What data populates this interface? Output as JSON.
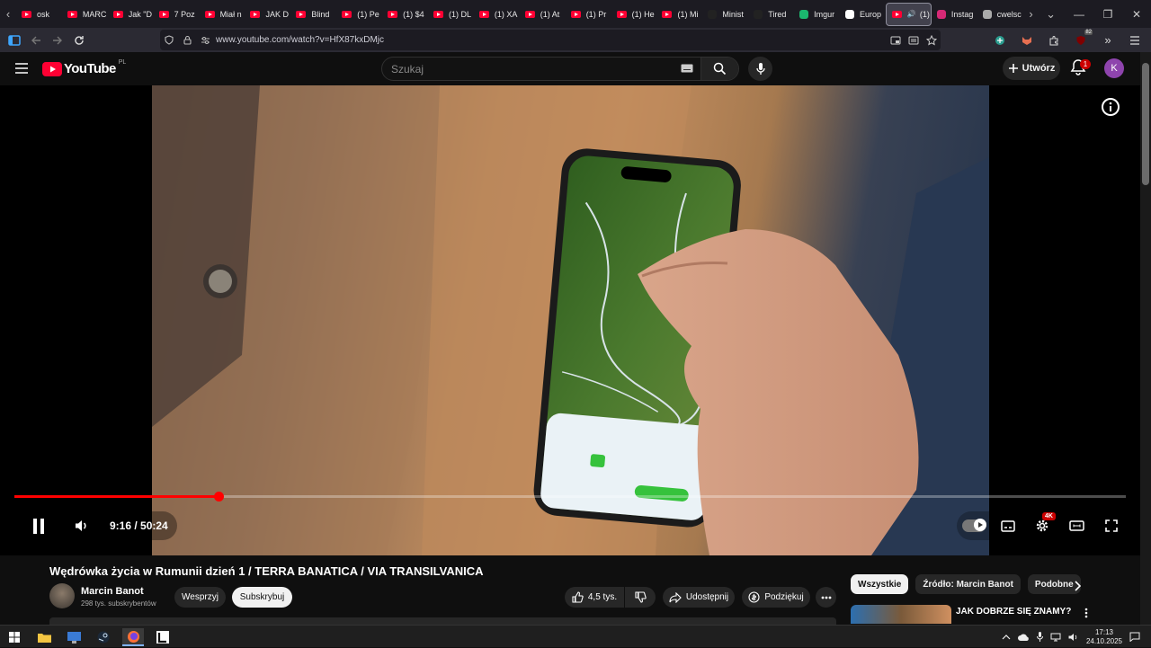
{
  "browser": {
    "tabs": [
      {
        "label": "osk",
        "active": false
      },
      {
        "label": "MARC",
        "active": false
      },
      {
        "label": "Jak \"D",
        "active": false
      },
      {
        "label": "7 Poz",
        "active": false
      },
      {
        "label": "Miał n",
        "active": false
      },
      {
        "label": "JAK D",
        "active": false
      },
      {
        "label": "Blind",
        "active": false
      },
      {
        "label": "(1) Pe",
        "active": false
      },
      {
        "label": "(1) $4",
        "active": false
      },
      {
        "label": "(1) DL",
        "active": false
      },
      {
        "label": "(1) XA",
        "active": false
      },
      {
        "label": "(1) At",
        "active": false
      },
      {
        "label": "(1) Pr",
        "active": false
      },
      {
        "label": "(1) He",
        "active": false
      },
      {
        "label": "(1) Mi",
        "active": false
      },
      {
        "label": "Minist",
        "active": false
      },
      {
        "label": "Tired",
        "active": false
      },
      {
        "label": "Imgur",
        "active": false
      },
      {
        "label": "Europ",
        "active": false
      },
      {
        "label": "(1)",
        "active": true
      },
      {
        "label": "Instag",
        "active": false
      },
      {
        "label": "cwelsc",
        "active": false
      }
    ],
    "url": "www.youtube.com/watch?v=HfX87kxDMjc",
    "extension_badge": "82"
  },
  "youtube": {
    "logo_text": "YouTube",
    "region": "PL",
    "search_placeholder": "Szukaj",
    "create_label": "Utwórz",
    "notifications_count": "1",
    "avatar_letter": "K"
  },
  "player": {
    "progress_fraction": 0.1838,
    "current_time": "9:16",
    "duration": "50:24",
    "time_display": "9:16 / 50:24",
    "quality_badge": "4K"
  },
  "video": {
    "title": "Wędrówka życia w Rumunii dzień 1 / TERRA BANATICA / VIA TRANSILVANICA",
    "channel_name": "Marcin Banot",
    "subscribers": "298 tys. subskrybentów",
    "support_label": "Wesprzyj",
    "subscribe_label": "Subskrybuj",
    "likes": "4,5 tys.",
    "share_label": "Udostępnij",
    "thanks_label": "Podziękuj"
  },
  "sidebar": {
    "chips": [
      "Wszystkie",
      "Źródło: Marcin Banot",
      "Podobne"
    ],
    "rec_title": "JAK DOBRZE SIĘ ZNAMY?"
  },
  "taskbar": {
    "time": "17:13",
    "date": "24.10.2025"
  }
}
